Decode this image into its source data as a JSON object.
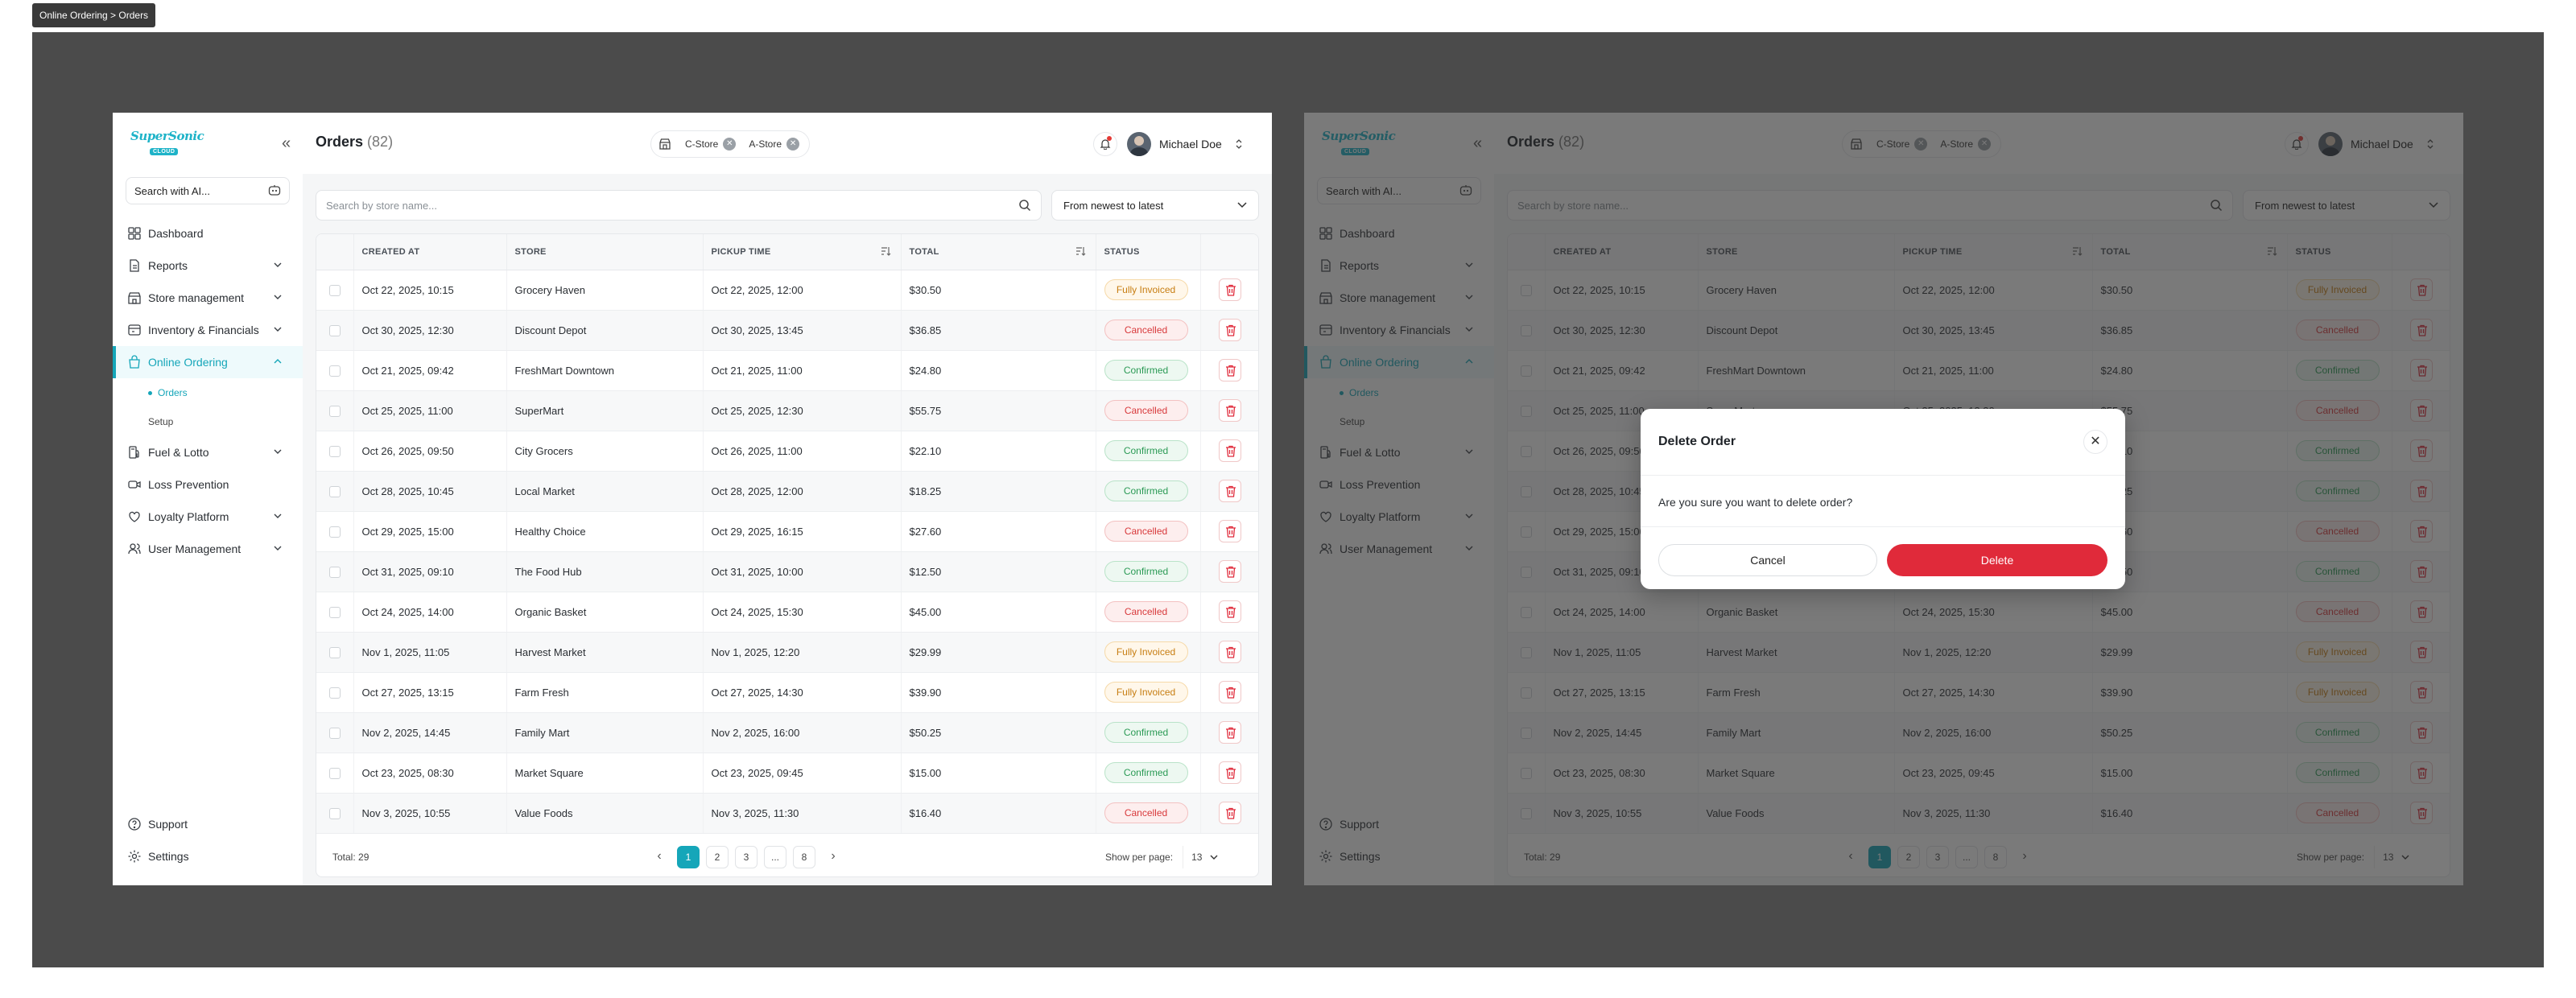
{
  "breadcrumb_tag": "Online Ordering > Orders",
  "brand": {
    "logo_text": "SuperSonic",
    "logo_sub": "CLOUD",
    "accent": "#15a6b9",
    "danger": "#e02a3a"
  },
  "sidebar": {
    "ai_search_placeholder": "Search with AI...",
    "items": [
      {
        "label": "Dashboard",
        "icon": "grid-icon",
        "chevron": false
      },
      {
        "label": "Reports",
        "icon": "report-icon",
        "chevron": true
      },
      {
        "label": "Store management",
        "icon": "store-icon",
        "chevron": true
      },
      {
        "label": "Inventory & Financials",
        "icon": "inventory-icon",
        "chevron": true
      },
      {
        "label": "Online Ordering",
        "icon": "bag-icon",
        "chevron": true,
        "active": true
      },
      {
        "label": "Fuel & Lotto",
        "icon": "fuel-icon",
        "chevron": true
      },
      {
        "label": "Loss Prevention",
        "icon": "camera-icon",
        "chevron": false
      },
      {
        "label": "Loyalty Platform",
        "icon": "loyalty-icon",
        "chevron": true
      },
      {
        "label": "User Management",
        "icon": "users-icon",
        "chevron": true
      }
    ],
    "sub_items": [
      {
        "label": "Orders",
        "active": true
      },
      {
        "label": "Setup",
        "active": false
      }
    ],
    "bottom": [
      {
        "label": "Support",
        "icon": "support-icon"
      },
      {
        "label": "Settings",
        "icon": "settings-icon"
      }
    ]
  },
  "header": {
    "title": "Orders",
    "count": "(82)",
    "store_chips": [
      "C-Store",
      "A-Store"
    ],
    "user_name": "Michael Doe"
  },
  "filters": {
    "search_placeholder": "Search by store name...",
    "sort_value": "From newest to latest"
  },
  "table": {
    "columns": [
      "CREATED AT",
      "STORE",
      "PICKUP TIME",
      "TOTAL",
      "STATUS"
    ],
    "rows": [
      {
        "created": "Oct 22, 2025, 10:15",
        "store": "Grocery Haven",
        "pickup": "Oct 22, 2025, 12:00",
        "total": "$30.50",
        "status": "Fully Invoiced",
        "kind": "inv"
      },
      {
        "created": "Oct 30, 2025, 12:30",
        "store": "Discount Depot",
        "pickup": "Oct 30, 2025, 13:45",
        "total": "$36.85",
        "status": "Cancelled",
        "kind": "can"
      },
      {
        "created": "Oct 21, 2025, 09:42",
        "store": "FreshMart Downtown",
        "pickup": "Oct 21, 2025, 11:00",
        "total": "$24.80",
        "status": "Confirmed",
        "kind": "con"
      },
      {
        "created": "Oct 25, 2025, 11:00",
        "store": "SuperMart",
        "pickup": "Oct 25, 2025, 12:30",
        "total": "$55.75",
        "status": "Cancelled",
        "kind": "can"
      },
      {
        "created": "Oct 26, 2025, 09:50",
        "store": "City Grocers",
        "pickup": "Oct 26, 2025, 11:00",
        "total": "$22.10",
        "status": "Confirmed",
        "kind": "con"
      },
      {
        "created": "Oct 28, 2025, 10:45",
        "store": "Local Market",
        "pickup": "Oct 28, 2025, 12:00",
        "total": "$18.25",
        "status": "Confirmed",
        "kind": "con"
      },
      {
        "created": "Oct 29, 2025, 15:00",
        "store": "Healthy Choice",
        "pickup": "Oct 29, 2025, 16:15",
        "total": "$27.60",
        "status": "Cancelled",
        "kind": "can"
      },
      {
        "created": "Oct 31, 2025, 09:10",
        "store": "The Food Hub",
        "pickup": "Oct 31, 2025, 10:00",
        "total": "$12.50",
        "status": "Confirmed",
        "kind": "con"
      },
      {
        "created": "Oct 24, 2025, 14:00",
        "store": "Organic Basket",
        "pickup": "Oct 24, 2025, 15:30",
        "total": "$45.00",
        "status": "Cancelled",
        "kind": "can"
      },
      {
        "created": "Nov 1, 2025, 11:05",
        "store": "Harvest Market",
        "pickup": "Nov 1, 2025, 12:20",
        "total": "$29.99",
        "status": "Fully Invoiced",
        "kind": "inv"
      },
      {
        "created": "Oct 27, 2025, 13:15",
        "store": "Farm Fresh",
        "pickup": "Oct 27, 2025, 14:30",
        "total": "$39.90",
        "status": "Fully Invoiced",
        "kind": "inv"
      },
      {
        "created": "Nov 2, 2025, 14:45",
        "store": "Family Mart",
        "pickup": "Nov 2, 2025, 16:00",
        "total": "$50.25",
        "status": "Confirmed",
        "kind": "con"
      },
      {
        "created": "Oct 23, 2025, 08:30",
        "store": "Market Square",
        "pickup": "Oct 23, 2025, 09:45",
        "total": "$15.00",
        "status": "Confirmed",
        "kind": "con"
      },
      {
        "created": "Nov 3, 2025, 10:55",
        "store": "Value Foods",
        "pickup": "Nov 3, 2025, 11:30",
        "total": "$16.40",
        "status": "Cancelled",
        "kind": "can"
      }
    ]
  },
  "pagination": {
    "total_label": "Total: 29",
    "pages": [
      "1",
      "2",
      "3",
      "...",
      "8"
    ],
    "current": "1",
    "per_page_label": "Show per page:",
    "per_page_value": "13"
  },
  "modal": {
    "title": "Delete Order",
    "message": "Are you sure you want to delete order?",
    "cancel_label": "Cancel",
    "delete_label": "Delete"
  }
}
